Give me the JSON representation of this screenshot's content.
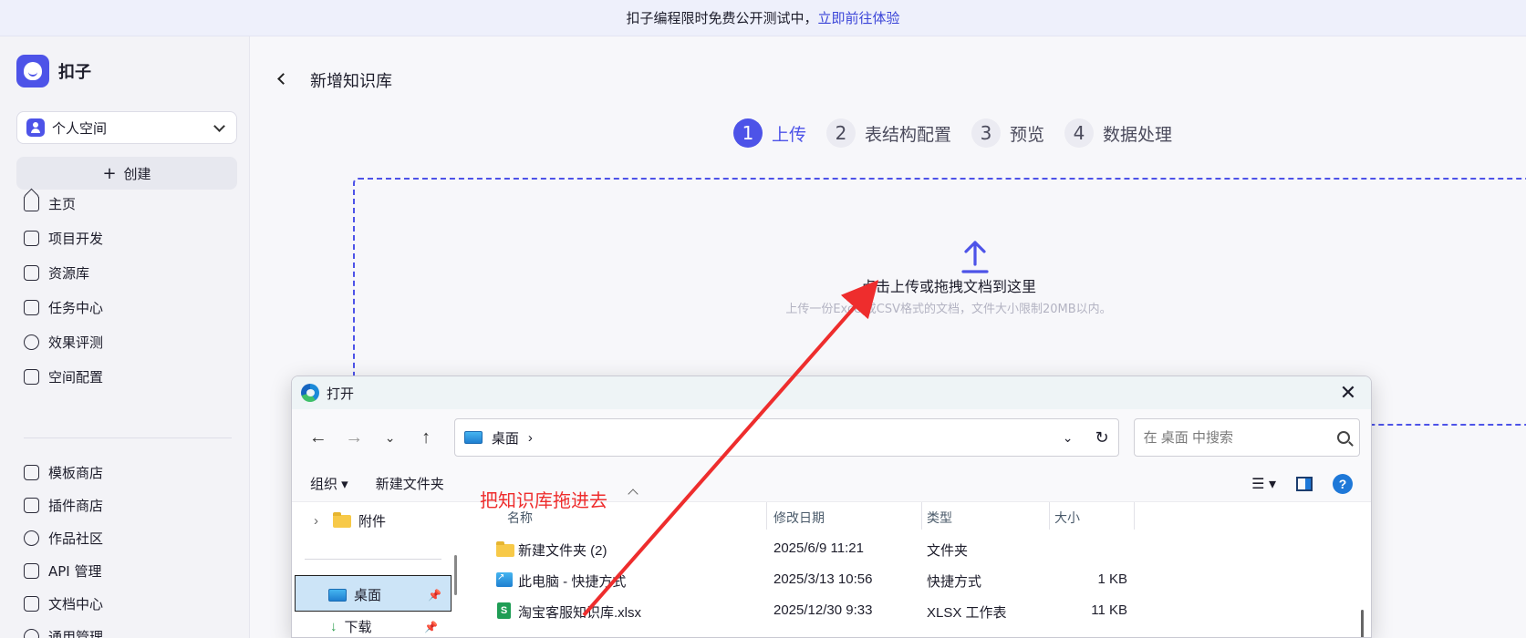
{
  "banner": {
    "text": "扣子编程限时免费公开测试中，",
    "link": "立即前往体验"
  },
  "brand": {
    "name": "扣子"
  },
  "workspace": {
    "label": "个人空间"
  },
  "create": {
    "label": "创建"
  },
  "nav": {
    "items": [
      {
        "label": "主页",
        "icon": "home-icon"
      },
      {
        "label": "项目开发",
        "icon": "bot-icon"
      },
      {
        "label": "资源库",
        "icon": "library-icon"
      },
      {
        "label": "任务中心",
        "icon": "task-icon"
      },
      {
        "label": "效果评测",
        "icon": "gauge-icon"
      },
      {
        "label": "空间配置",
        "icon": "terminal-icon"
      }
    ],
    "secondary": [
      {
        "label": "模板商店",
        "icon": "template-icon"
      },
      {
        "label": "插件商店",
        "icon": "plugin-icon"
      },
      {
        "label": "作品社区",
        "icon": "planet-icon"
      },
      {
        "label": "API 管理",
        "icon": "api-icon"
      },
      {
        "label": "文档中心",
        "icon": "doc-icon"
      },
      {
        "label": "通用管理",
        "icon": "settings-icon"
      }
    ]
  },
  "page": {
    "title": "新增知识库"
  },
  "steps": [
    {
      "num": "1",
      "label": "上传",
      "active": true
    },
    {
      "num": "2",
      "label": "表结构配置",
      "active": false
    },
    {
      "num": "3",
      "label": "预览",
      "active": false
    },
    {
      "num": "4",
      "label": "数据处理",
      "active": false
    }
  ],
  "upload": {
    "title": "点击上传或拖拽文档到这里",
    "subtitle": "上传一份Excel或CSV格式的文档，文件大小限制20MB以内。"
  },
  "dialog": {
    "title": "打开",
    "path": "桌面",
    "search_placeholder": "在 桌面 中搜索",
    "toolbar": {
      "organize": "组织 ▾",
      "new_folder": "新建文件夹"
    },
    "tree": {
      "attachments": "附件",
      "desktop": "桌面",
      "downloads": "下载"
    },
    "columns": {
      "name": "名称",
      "modified": "修改日期",
      "type": "类型",
      "size": "大小"
    },
    "rows": [
      {
        "name": "新建文件夹 (2)",
        "modified": "2025/6/9 11:21",
        "type": "文件夹",
        "size": "",
        "icon": "folder-icon"
      },
      {
        "name": "此电脑 - 快捷方式",
        "modified": "2025/3/13 10:56",
        "type": "快捷方式",
        "size": "1 KB",
        "icon": "shortcut-icon"
      },
      {
        "name": "淘宝客服知识库.xlsx",
        "modified": "2025/12/30 9:33",
        "type": "XLSX 工作表",
        "size": "11 KB",
        "icon": "xlsx-icon"
      }
    ]
  },
  "annotation": {
    "text": "把知识库拖进去",
    "color": "#ee2d2d"
  },
  "colors": {
    "accent": "#4d53e8",
    "annotation": "#ee2d2d",
    "banner_bg": "#eef0fb"
  }
}
